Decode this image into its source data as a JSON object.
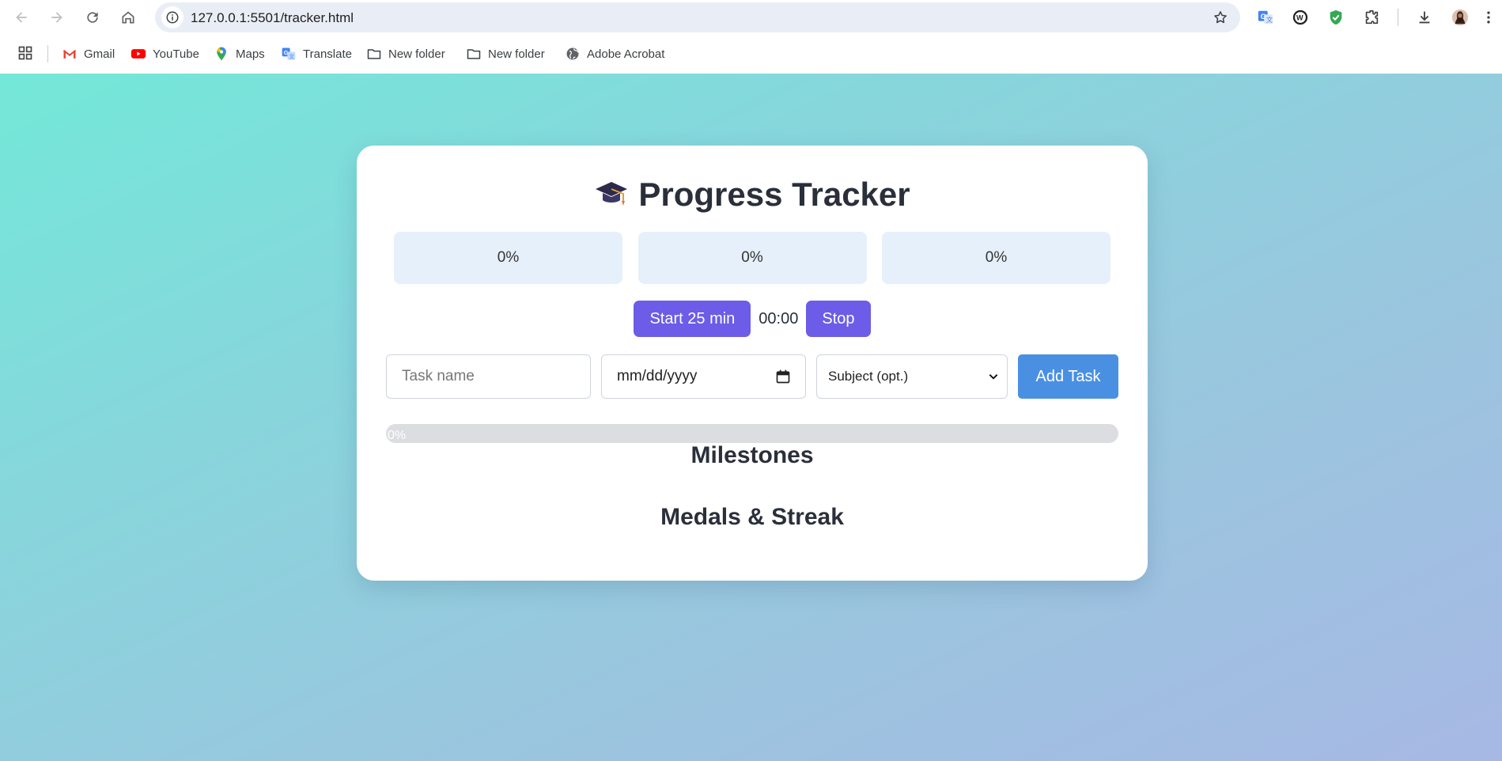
{
  "browser": {
    "url": "127.0.0.1:5501/tracker.html",
    "bookmarks": [
      {
        "label": "Gmail",
        "icon": "gmail-icon"
      },
      {
        "label": "YouTube",
        "icon": "youtube-icon"
      },
      {
        "label": "Maps",
        "icon": "maps-icon"
      },
      {
        "label": "Translate",
        "icon": "translate-icon"
      },
      {
        "label": "New folder",
        "icon": "folder-icon"
      },
      {
        "label": "New folder",
        "icon": "folder-icon"
      },
      {
        "label": "Adobe Acrobat",
        "icon": "globe-icon"
      }
    ]
  },
  "page": {
    "title": "Progress Tracker",
    "title_icon": "graduation-cap-icon",
    "stats": [
      "0%",
      "0%",
      "0%"
    ],
    "timer": {
      "start_label": "Start 25 min",
      "display": "00:00",
      "stop_label": "Stop"
    },
    "form": {
      "task_placeholder": "Task name",
      "date_placeholder": "mm/dd/yyyy",
      "subject_selected": "Subject (opt.)",
      "add_label": "Add Task"
    },
    "progress": {
      "label": "0%",
      "value": 0
    },
    "milestones_heading": "Milestones",
    "medals_heading": "Medals & Streak"
  },
  "colors": {
    "accent_purple": "#6c5ce7",
    "accent_blue": "#4a90e2",
    "stat_bg": "#e6f0fa"
  }
}
